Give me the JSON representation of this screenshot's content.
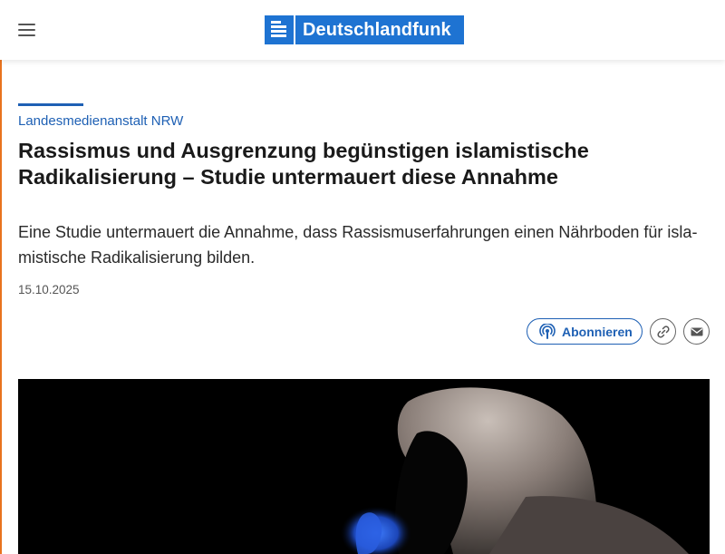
{
  "header": {
    "menu_icon": "hamburger-menu-icon",
    "logo_text": "Deutschlandfunk",
    "brand_color": "#1e73d2"
  },
  "article": {
    "kicker": "Landesmedienanstalt NRW",
    "title": "Rassismus und Ausgrenzung begünstigen islamistische Radikalisie­rung – Studie untermauert diese Annahme",
    "teaser": "Eine Studie untermauert die Annahme, dass Rassismuserfahrungen einen Nährboden für isla­mistische Radikalisierung bilden.",
    "date": "15.10.2025",
    "accent_color": "#1e60b4"
  },
  "actions": {
    "subscribe_label": "Abonnieren",
    "subscribe_icon": "podcast-icon",
    "link_icon": "link-icon",
    "mail_icon": "mail-icon"
  },
  "image": {
    "subject": "hooded-person-silhouette"
  }
}
